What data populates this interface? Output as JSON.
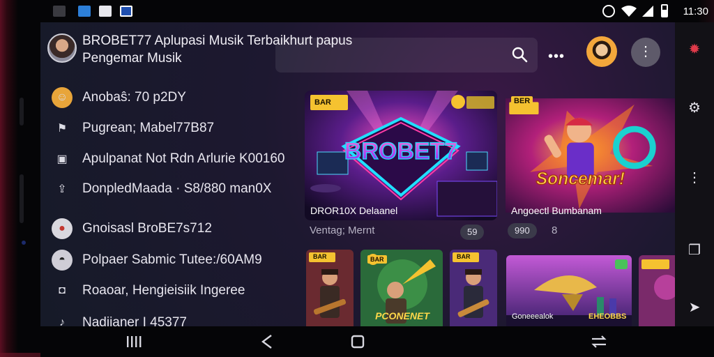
{
  "statusbar": {
    "time": "11:30",
    "left_icons": [
      "app-icon",
      "download-icon",
      "mail-icon",
      "store-icon"
    ],
    "right_icons": [
      "nfc-icon",
      "wifi-icon",
      "signal-icon",
      "battery-icon"
    ]
  },
  "header": {
    "title": "BROBET77 Aplupasi Musik Terbaikhurt papus Pengemar Musik",
    "search_placeholder": ""
  },
  "menu": [
    {
      "label": "Anobaŝ: 70 p2DY",
      "icon": "emoji-icon"
    },
    {
      "label": "Pugrean; Mabel77B87",
      "icon": "flag-icon"
    },
    {
      "label": "Apulpanat Not Rdn Arlurie K00160",
      "icon": "square-icon"
    },
    {
      "label": "DonpledMaada · S8/880 man0X",
      "icon": "share-icon"
    },
    {
      "label": "Gnoisasl BroBE7s712",
      "icon": "badge-icon"
    },
    {
      "label": "Polpaer Sabmic Tutee:/60AM9",
      "icon": "mask-icon"
    },
    {
      "label": "Roaoar, Hengieisiik Ingeree",
      "icon": "frame-icon"
    },
    {
      "label": "Nadiianer I 45377",
      "icon": "music-icon"
    }
  ],
  "featured": [
    {
      "caption": "DROR10X Delaanel",
      "badge": "BAR",
      "art_text": "BROBET7"
    },
    {
      "caption": "Angoectl Bumbanam",
      "badge": "BER",
      "art_text": "Soncemar!"
    }
  ],
  "featured_meta": {
    "left_text": "Ventag;  Mernt",
    "left_pill": "59",
    "right_pill": "990",
    "right_extra": "8"
  },
  "grid": [
    {
      "caption": "",
      "badge": "BAR"
    },
    {
      "caption": "PCONENET",
      "badge": "BAR"
    },
    {
      "caption": "",
      "badge": "BAR"
    },
    {
      "caption": "Goneeealok",
      "badge": ""
    },
    {
      "caption": "EHEOBBS",
      "badge": ""
    }
  ],
  "rail_icons": [
    "bug-icon",
    "settings-icon",
    "list-icon",
    "copy-icon",
    "back-arrow-icon"
  ],
  "navbar": [
    "recent-apps-icon",
    "back-icon",
    "home-icon",
    "switch-icon"
  ],
  "colors": {
    "accent": "#f5c230",
    "neon_pink": "#ff3ca6",
    "neon_purple": "#9b4dff",
    "neon_cyan": "#23d6ff",
    "background": "#1d1830"
  }
}
